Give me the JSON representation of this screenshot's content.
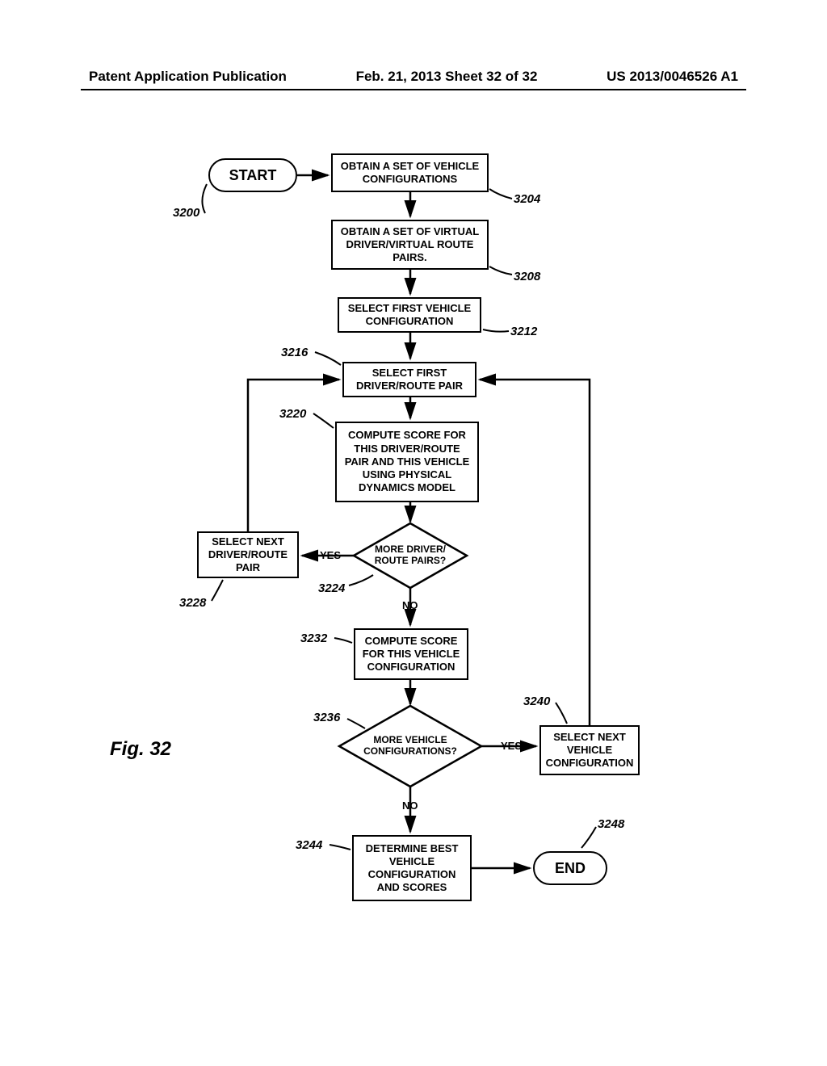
{
  "header": {
    "left": "Patent Application Publication",
    "center": "Feb. 21, 2013  Sheet 32 of 32",
    "right": "US 2013/0046526 A1"
  },
  "figure_label": "Fig. 32",
  "nodes": {
    "start": "START",
    "end": "END",
    "b3204": "OBTAIN A SET OF VEHICLE CONFIGURATIONS",
    "b3208": "OBTAIN A SET OF VIRTUAL DRIVER/VIRTUAL ROUTE PAIRS.",
    "b3212": "SELECT FIRST VEHICLE CONFIGURATION",
    "b3216": "SELECT FIRST DRIVER/ROUTE PAIR",
    "b3220": "COMPUTE SCORE FOR THIS DRIVER/ROUTE PAIR AND THIS VEHICLE USING PHYSICAL DYNAMICS MODEL",
    "d3224": "MORE DRIVER/ ROUTE PAIRS?",
    "b3228": "SELECT NEXT DRIVER/ROUTE PAIR",
    "b3232": "COMPUTE SCORE FOR THIS VEHICLE CONFIGURATION",
    "d3236": "MORE VEHICLE CONFIGURATIONS?",
    "b3240": "SELECT NEXT VEHICLE CONFIGURATION",
    "b3244": "DETERMINE BEST VEHICLE CONFIGURATION AND SCORES"
  },
  "refs": {
    "r3200": "3200",
    "r3204": "3204",
    "r3208": "3208",
    "r3212": "3212",
    "r3216": "3216",
    "r3220": "3220",
    "r3224": "3224",
    "r3228": "3228",
    "r3232": "3232",
    "r3236": "3236",
    "r3240": "3240",
    "r3244": "3244",
    "r3248": "3248"
  },
  "edge_labels": {
    "yes1": "YES",
    "no1": "NO",
    "yes2": "YES",
    "no2": "NO"
  }
}
